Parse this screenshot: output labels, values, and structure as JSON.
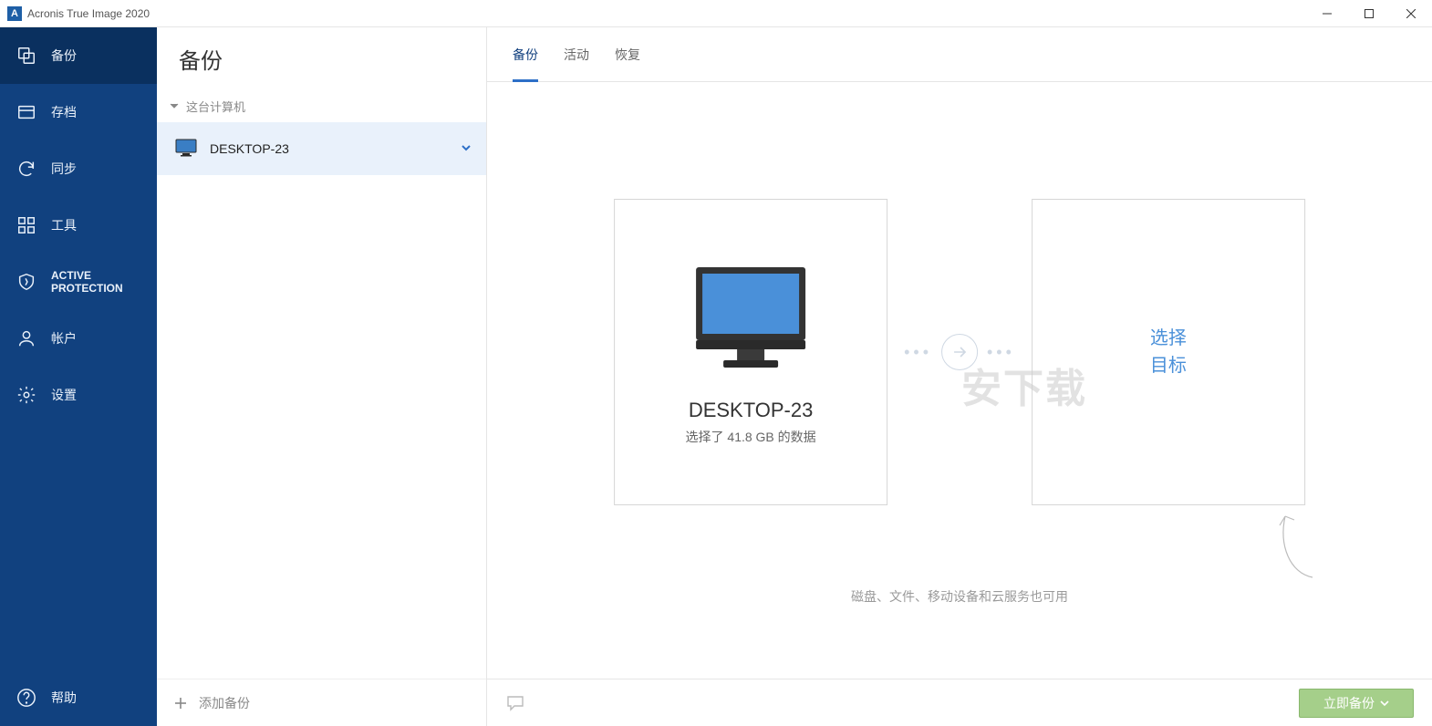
{
  "titlebar": {
    "title": "Acronis True Image 2020",
    "logo_letter": "A"
  },
  "sidebar": {
    "items": [
      {
        "label": "备份"
      },
      {
        "label": "存档"
      },
      {
        "label": "同步"
      },
      {
        "label": "工具"
      },
      {
        "label_line1": "ACTIVE",
        "label_line2": "PROTECTION"
      },
      {
        "label": "帐户"
      },
      {
        "label": "设置"
      }
    ],
    "help_label": "帮助"
  },
  "listpane": {
    "title": "备份",
    "group_label": "这台计算机",
    "item_name": "DESKTOP-23",
    "add_label": "添加备份"
  },
  "tabs": {
    "items": [
      {
        "label": "备份"
      },
      {
        "label": "活动"
      },
      {
        "label": "恢复"
      }
    ]
  },
  "source": {
    "name": "DESKTOP-23",
    "subtitle": "选择了 41.8 GB 的数据"
  },
  "destination": {
    "line1": "选择",
    "line2": "目标"
  },
  "hint": "磁盘、文件、移动设备和云服务也可用",
  "backup_button": "立即备份",
  "watermark": "安下载"
}
